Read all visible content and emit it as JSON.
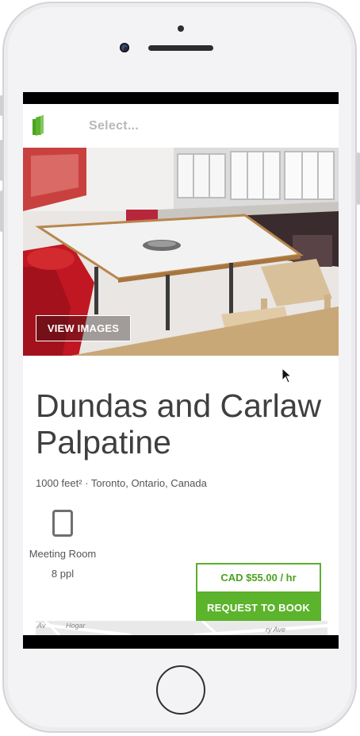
{
  "appbar": {
    "select_placeholder": "Select..."
  },
  "hero": {
    "view_images_label": "VIEW IMAGES"
  },
  "listing": {
    "title": "Dundas and Carlaw Palpatine",
    "meta": "1000 feet² · Toronto, Ontario, Canada",
    "room_type": "Meeting Room",
    "capacity": "8 ppl"
  },
  "booking": {
    "price": "CAD $55.00 / hr",
    "request_label": "REQUEST TO BOOK"
  },
  "map": {
    "street_left": "Hogar",
    "street_right": "ry Ave",
    "street_edge": "Av"
  },
  "colors": {
    "accent_green": "#5cb32c",
    "logo_green": "#4aa320"
  },
  "icons": [
    "door-logo-icon",
    "meeting-room-icon",
    "mouse-cursor-icon"
  ]
}
